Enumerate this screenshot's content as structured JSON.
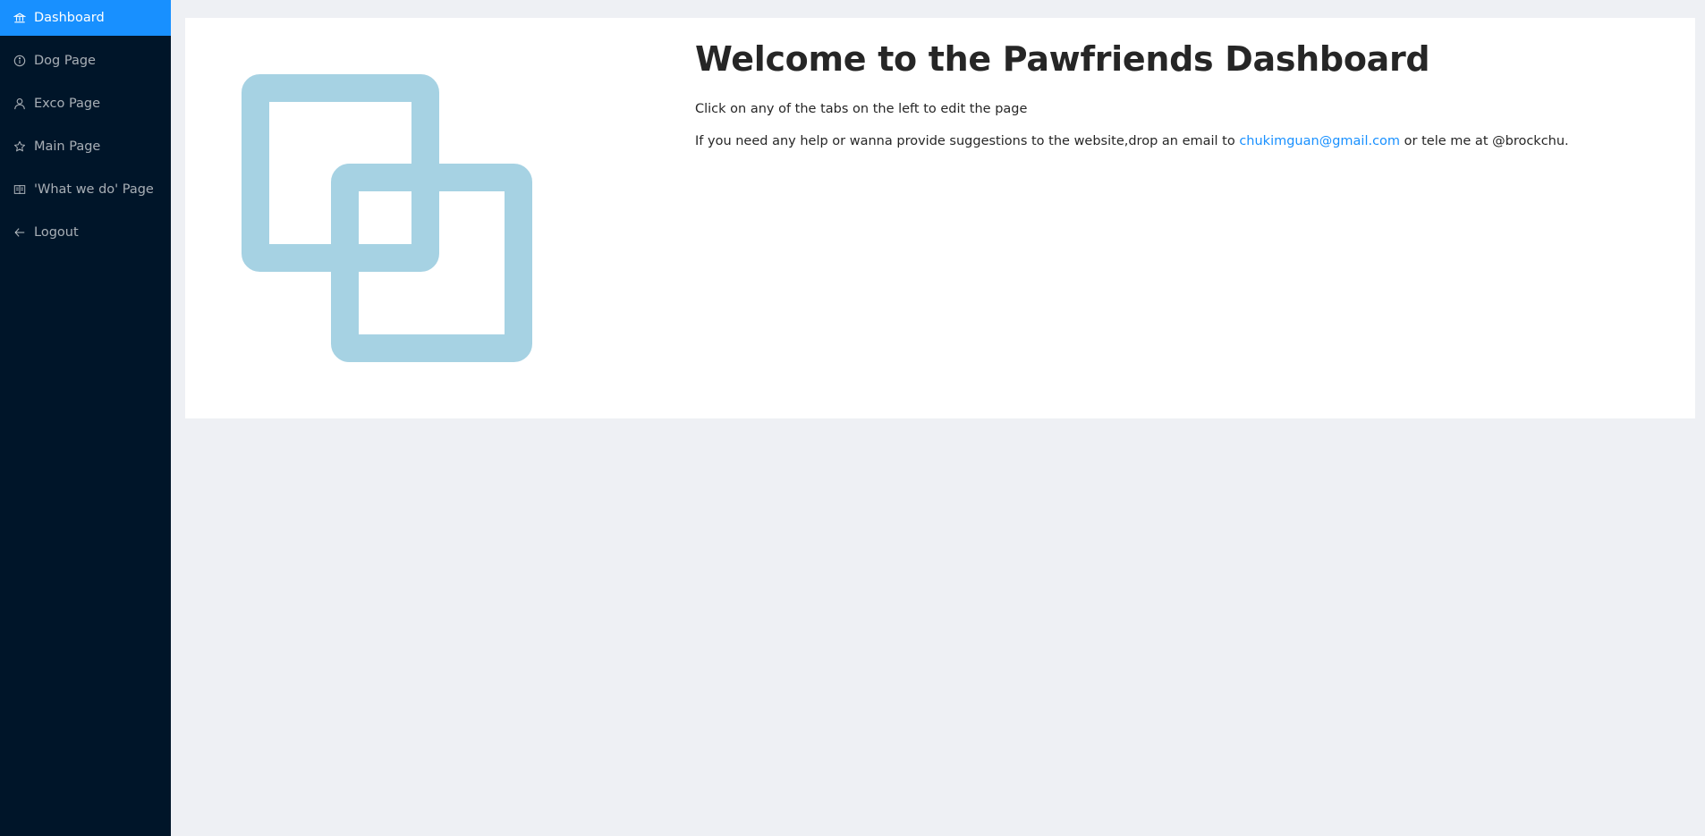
{
  "sidebar": {
    "items": [
      {
        "label": "Dashboard",
        "icon": "bank-icon",
        "active": true
      },
      {
        "label": "Dog Page",
        "icon": "info-circle-icon"
      },
      {
        "label": "Exco Page",
        "icon": "user-icon"
      },
      {
        "label": "Main Page",
        "icon": "star-icon"
      },
      {
        "label": "'What we do' Page",
        "icon": "read-icon"
      },
      {
        "label": "Logout",
        "icon": "arrow-left-icon"
      }
    ]
  },
  "main": {
    "title": "Welcome to the Pawfriends Dashboard",
    "instruction": "Click on any of the tabs on the left to edit the page",
    "help_prefix": "If you need any help or wanna provide suggestions to the website,drop an email to ",
    "email": "chukimguan@gmail.com",
    "help_suffix": " or tele me at @brockchu."
  },
  "colors": {
    "sidebar_bg": "#001529",
    "active_bg": "#1890ff",
    "page_bg": "#eef0f4",
    "logo_color": "#a6d2e3",
    "link_color": "#1890ff"
  }
}
